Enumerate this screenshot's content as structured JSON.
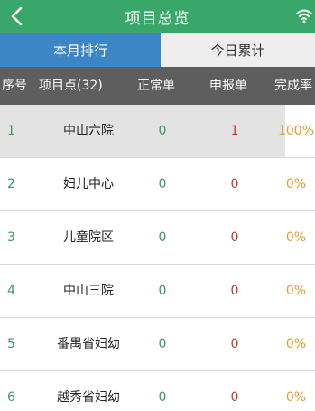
{
  "header": {
    "title": "项目总览"
  },
  "tabs": [
    {
      "label": "本月排行",
      "active": true
    },
    {
      "label": "今日累计",
      "active": false
    }
  ],
  "table": {
    "columns": [
      "序号",
      "项目点(32)",
      "正常单",
      "申报单",
      "完成率"
    ],
    "rows": [
      {
        "index": "1",
        "name": "中山六院",
        "normal": "0",
        "report": "1",
        "rate": "100%",
        "progress": 1.0
      },
      {
        "index": "2",
        "name": "妇儿中心",
        "normal": "0",
        "report": "0",
        "rate": "0%",
        "progress": 0
      },
      {
        "index": "3",
        "name": "儿童院区",
        "normal": "0",
        "report": "0",
        "rate": "0%",
        "progress": 0
      },
      {
        "index": "4",
        "name": "中山三院",
        "normal": "0",
        "report": "0",
        "rate": "0%",
        "progress": 0
      },
      {
        "index": "5",
        "name": "番禺省妇幼",
        "normal": "0",
        "report": "0",
        "rate": "0%",
        "progress": 0
      },
      {
        "index": "6",
        "name": "越秀省妇幼",
        "normal": "0",
        "report": "0",
        "rate": "0%",
        "progress": 0
      }
    ]
  },
  "colors": {
    "titlebar": "#3aa76a",
    "tab_active": "#3d86c6",
    "table_header": "#5e5e5e",
    "normal_count": "#3a9a62",
    "report_count": "#c0392b",
    "rate": "#e89a2e"
  },
  "icons": {
    "back": "chevron-left-icon",
    "status": "wifi-icon"
  }
}
